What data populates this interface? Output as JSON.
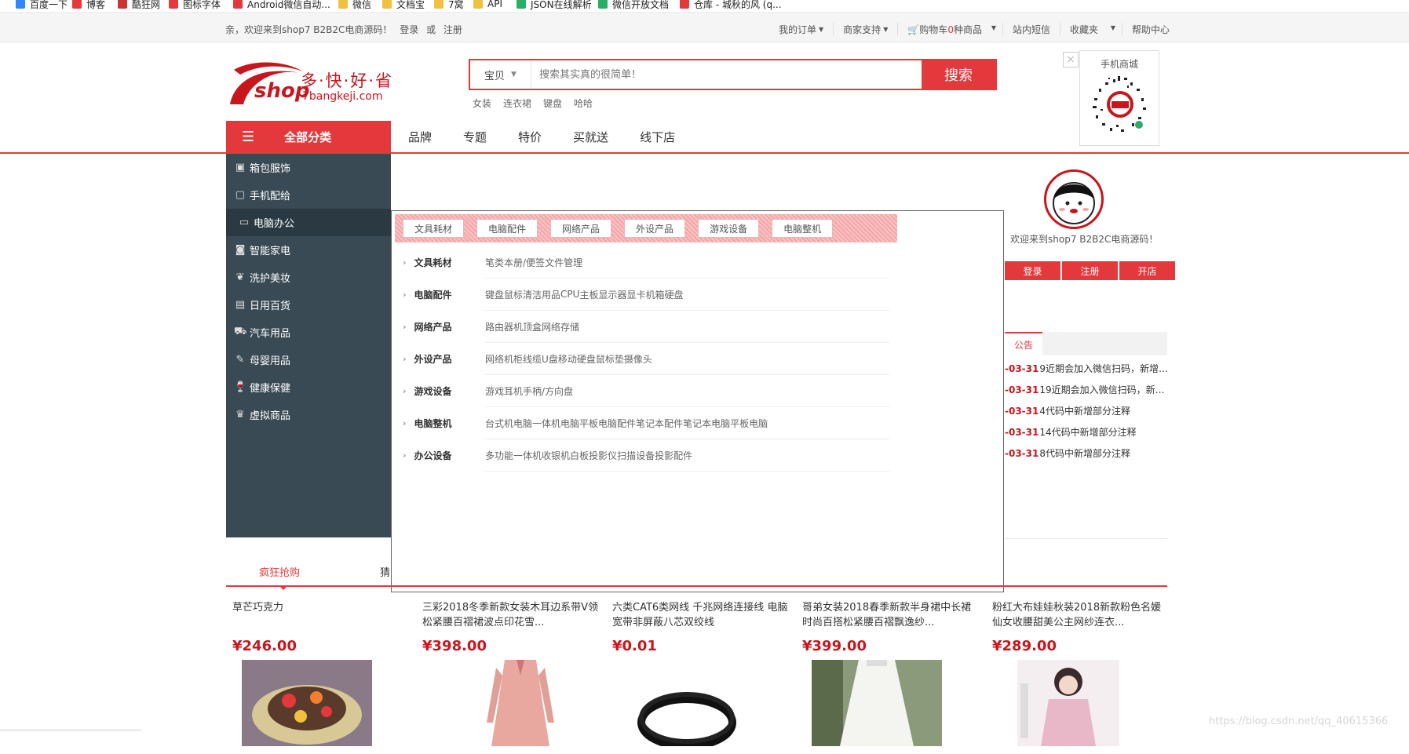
{
  "bookmarks": [
    {
      "label": "百度一下",
      "color": "#3385ff"
    },
    {
      "label": "博客",
      "color": "#e4393c"
    },
    {
      "label": "酷狂网",
      "color": "#c33"
    },
    {
      "label": "图标字体",
      "color": "#e4393c"
    },
    {
      "label": "Android微信自动...",
      "color": "#e4393c"
    },
    {
      "label": "微信",
      "color": "#f0c040"
    },
    {
      "label": "文档宝",
      "color": "#f0c040"
    },
    {
      "label": "7窝",
      "color": "#f0c040"
    },
    {
      "label": "API",
      "color": "#f0c040"
    },
    {
      "label": "JSON在线解析",
      "color": "#2aae67"
    },
    {
      "label": "微信开放文档",
      "color": "#2aae67"
    },
    {
      "label": "仓库 - 城秋的风 (q...",
      "color": "#e4393c"
    }
  ],
  "topbar": {
    "welcome": "亲，欢迎来到shop7 B2B2C电商源码！",
    "login": "登录",
    "or": "或",
    "register": "注册",
    "nav": {
      "orders": "我的订单",
      "seller": "商家支持",
      "cart_pre": "购物车",
      "cart_count": "0",
      "cart_post": "种商品",
      "messages": "站内短信",
      "favorites": "收藏夹",
      "help": "帮助中心"
    }
  },
  "logo": {
    "cn": "多·快·好·省",
    "en": "7bangkeji.com",
    "shop": "shop"
  },
  "search": {
    "type": "宝贝",
    "placeholder": "搜索其实真的很简单！",
    "button": "搜索",
    "hotwords": [
      "女装",
      "连衣裙",
      "键盘",
      "哈哈"
    ]
  },
  "qr": {
    "title": "手机商城",
    "close": "×"
  },
  "catbtn": {
    "label": "全部分类"
  },
  "mainnav": [
    "品牌",
    "专题",
    "特价",
    "买就送",
    "线下店"
  ],
  "sidebar": [
    {
      "label": "箱包服饰",
      "icon": "bag-icon"
    },
    {
      "label": "手机配给",
      "icon": "phone-icon"
    },
    {
      "label": "电脑办公",
      "icon": "computer-icon"
    },
    {
      "label": "智能家电",
      "icon": "appliance-icon"
    },
    {
      "label": "洗护美妆",
      "icon": "beauty-icon"
    },
    {
      "label": "日用百货",
      "icon": "daily-icon"
    },
    {
      "label": "汽车用品",
      "icon": "car-icon"
    },
    {
      "label": "母婴用品",
      "icon": "baby-icon"
    },
    {
      "label": "健康保健",
      "icon": "health-icon"
    },
    {
      "label": "虚拟商品",
      "icon": "virtual-icon"
    }
  ],
  "panel": {
    "chips": [
      "文具耗材",
      "电脑配件",
      "网络产品",
      "外设产品",
      "游戏设备",
      "电脑整机"
    ],
    "rows": [
      {
        "cat": "文具耗材",
        "subs": [
          "笔类",
          "本册/便签",
          "文件管理"
        ]
      },
      {
        "cat": "电脑配件",
        "subs": [
          "键盘",
          "鼠标",
          "清洁用品",
          "CPU",
          "主板",
          "显示器",
          "显卡",
          "机箱",
          "硬盘"
        ]
      },
      {
        "cat": "网络产品",
        "subs": [
          "路由器",
          "机顶盒",
          "网络存储"
        ]
      },
      {
        "cat": "外设产品",
        "subs": [
          "网络机柜",
          "线缆",
          "U盘",
          "移动硬盘",
          "鼠标垫",
          "摄像头"
        ]
      },
      {
        "cat": "游戏设备",
        "subs": [
          "游戏耳机",
          "手柄/方向盘"
        ]
      },
      {
        "cat": "电脑整机",
        "subs": [
          "台式机电脑",
          "一体机电脑",
          "平板电脑配件",
          "笔记本配件",
          "笔记本电脑",
          "平板电脑"
        ]
      },
      {
        "cat": "办公设备",
        "subs": [
          "多功能一体机",
          "收银机",
          "白板",
          "投影仪",
          "扫描设备",
          "投影配件"
        ]
      }
    ]
  },
  "user": {
    "welcome": "欢迎来到shop7 B2B2C电商源码！",
    "login": "登录",
    "register": "注册",
    "open_store": "开店"
  },
  "notice": {
    "title": "公告",
    "items": [
      {
        "date": "-03-31",
        "text": "9近期会加入微信扫码，新增…"
      },
      {
        "date": "-03-31",
        "text": "19近期会加入微信扫码，新…"
      },
      {
        "date": "-03-31",
        "text": "4代码中新增部分注释"
      },
      {
        "date": "-03-31",
        "text": "14代码中新增部分注释"
      },
      {
        "date": "-03-31",
        "text": "8代码中新增部分注释"
      }
    ]
  },
  "tabs": {
    "active": "疯狂抢购",
    "second": "猜"
  },
  "products": [
    {
      "name": "草芒巧克力",
      "price": "¥246.00"
    },
    {
      "name": "三彩2018冬季新款女装木耳边系带V领松紧腰百褶裙波点印花雪...",
      "price": "¥398.00"
    },
    {
      "name": "六类CAT6类网线 千兆网络连接线 电脑宽带非屏蔽八芯双绞线",
      "price": "¥0.01"
    },
    {
      "name": "哥弟女装2018春季新款半身裙中长裙时尚百搭松紧腰百褶飘逸纱...",
      "price": "¥399.00"
    },
    {
      "name": "粉红大布娃娃秋装2018新款粉色名媛仙女收腰甜美公主网纱连衣...",
      "price": "¥289.00"
    }
  ],
  "watermark": "https://blog.csdn.net/qq_40615366",
  "colors": {
    "accent": "#e4393c",
    "sidebar": "#394a54",
    "sidebar_active": "#2b3a42"
  }
}
